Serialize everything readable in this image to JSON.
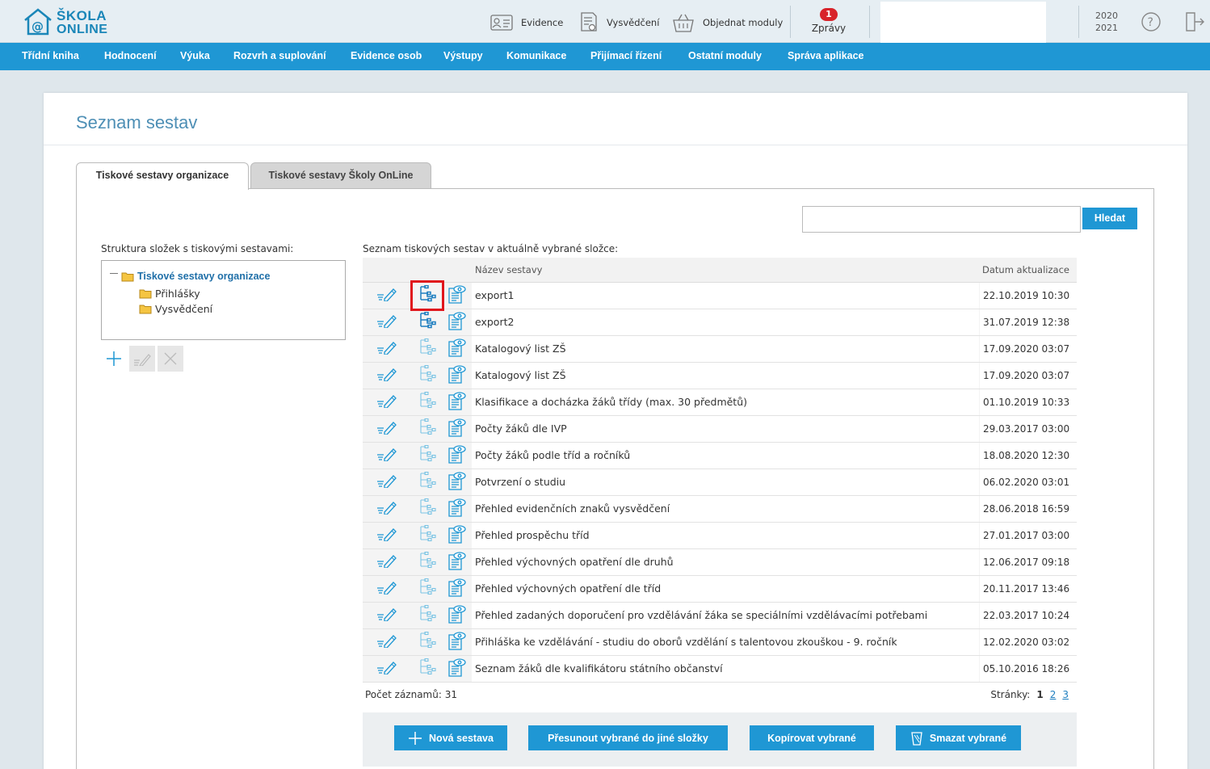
{
  "app": {
    "logo_line1": "ŠKOLA",
    "logo_line2": "ONLINE",
    "accent": "#1f97d4",
    "highlight": "#e0161d"
  },
  "topbar": {
    "evidence": "Evidence",
    "vysvedceni": "Vysvědčení",
    "objednat": "Objednat moduly",
    "messages_count": "1",
    "messages_label": "Zprávy",
    "year_from": "2020",
    "year_to": "2021"
  },
  "nav": [
    "Třídní kniha",
    "Hodnocení",
    "Výuka",
    "Rozvrh a suplování",
    "Evidence osob",
    "Výstupy",
    "Komunikace",
    "Přijímací řízení",
    "Ostatní moduly",
    "Správa aplikace"
  ],
  "page": {
    "title": "Seznam sestav"
  },
  "tabs": {
    "active": "Tiskové sestavy organizace",
    "inactive": "Tiskové sestavy Školy OnLine"
  },
  "search": {
    "value": "",
    "button": "Hledat"
  },
  "tree": {
    "label": "Struktura složek s tiskovými sestavami:",
    "root": "Tiskové sestavy organizace",
    "children": [
      "Přihlášky",
      "Vysvědčení"
    ]
  },
  "list": {
    "label": "Seznam tiskových sestav v aktuálně vybrané složce:",
    "col_name": "Název sestavy",
    "col_date": "Datum aktualizace",
    "rows": [
      {
        "name": "export1",
        "date": "22.10.2019 10:30"
      },
      {
        "name": "export2",
        "date": "31.07.2019 12:38"
      },
      {
        "name": "Katalogový list ZŠ",
        "date": "17.09.2020 03:07"
      },
      {
        "name": "Katalogový list ZŠ",
        "date": "17.09.2020 03:07"
      },
      {
        "name": "Klasifikace a docházka žáků třídy (max. 30 předmětů)",
        "date": "01.10.2019 10:33"
      },
      {
        "name": "Počty žáků dle IVP",
        "date": "29.03.2017 03:00"
      },
      {
        "name": "Počty žáků podle tříd a ročníků",
        "date": "18.08.2020 12:30"
      },
      {
        "name": "Potvrzení o studiu",
        "date": "06.02.2020 03:01"
      },
      {
        "name": "Přehled evidenčních znaků vysvědčení",
        "date": "28.06.2018 16:59"
      },
      {
        "name": "Přehled prospěchu tříd",
        "date": "27.01.2017 03:00"
      },
      {
        "name": "Přehled výchovných opatření dle druhů",
        "date": "12.06.2017 09:18"
      },
      {
        "name": "Přehled výchovných opatření dle tříd",
        "date": "20.11.2017 13:46"
      },
      {
        "name": "Přehled zadaných doporučení pro vzdělávání žáka se speciálními vzdělávacími potřebami",
        "date": "22.03.2017 10:24"
      },
      {
        "name": "Přihláška ke vzdělávání - studiu do oborů vzdělání s talentovou zkouškou - 9. ročník",
        "date": "12.02.2020 03:02"
      },
      {
        "name": "Seznam žáků dle kvalifikátoru státního občanství",
        "date": "05.10.2016 18:26"
      }
    ],
    "count_label": "Počet záznamů: 31",
    "pages_label": "Stránky:",
    "pages": [
      "1",
      "2",
      "3"
    ]
  },
  "actions": {
    "new": "Nová sestava",
    "move": "Přesunout vybrané do jiné složky",
    "copy": "Kopírovat vybrané",
    "delete": "Smazat vybrané"
  }
}
